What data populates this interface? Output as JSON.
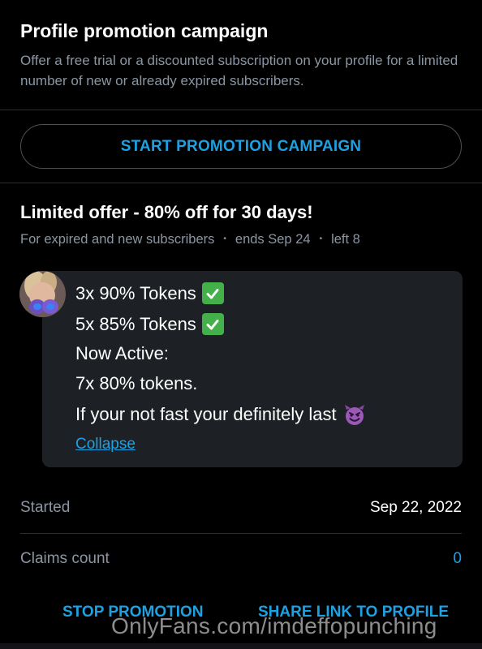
{
  "campaign": {
    "title": "Profile promotion campaign",
    "description": "Offer a free trial or a discounted subscription on your profile for a limited number of new or already expired subscribers.",
    "start_button": "START PROMOTION CAMPAIGN"
  },
  "offer": {
    "title": "Limited offer - 80% off for 30 days!",
    "audience": "For expired and new subscribers",
    "ends": "ends Sep 24",
    "left": "left 8",
    "separator": "•"
  },
  "message": {
    "lines": [
      "3x 90% Tokens",
      "5x 85% Tokens",
      "Now Active:",
      "7x 80% tokens.",
      "If your not fast your definitely last"
    ],
    "collapse_label": "Collapse"
  },
  "stats": {
    "started_label": "Started",
    "started_value": "Sep 22, 2022",
    "claims_label": "Claims count",
    "claims_value": "0"
  },
  "actions": {
    "stop": "STOP PROMOTION",
    "share": "SHARE LINK TO PROFILE"
  },
  "watermark": "OnlyFans.com/imdeffopunching",
  "icons": {
    "line1": "check-mark-button-icon",
    "line2": "check-mark-button-icon",
    "line5": "smiling-devil-icon"
  },
  "colors": {
    "accent": "#1da1e2",
    "background": "#000000",
    "muted_text": "#8a96a3",
    "bubble": "#1d2125"
  }
}
